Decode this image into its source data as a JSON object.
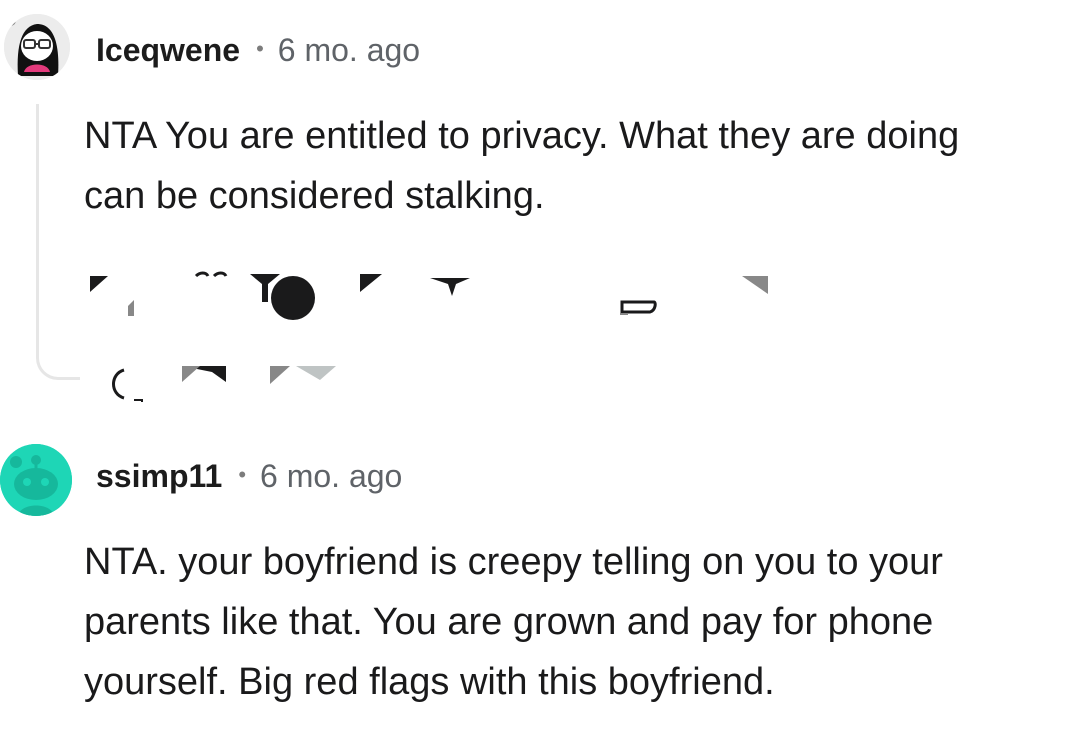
{
  "comments": [
    {
      "username": "Iceqwene",
      "separator": "•",
      "age": "6 mo. ago",
      "text_lines": [
        "NTA You are entitled to privacy. What they are doing",
        "can be considered stalking."
      ],
      "avatar_icon": "snoo-avatar-glasses-icon"
    },
    {
      "username": "ssimp11",
      "separator": "•",
      "age": "6 mo. ago",
      "text_lines": [
        "NTA. your boyfriend is creepy telling on you to your",
        "parents like that. You are grown and pay for phone",
        "yourself. Big red flags with this boyfriend."
      ],
      "avatar_icon": "snoo-avatar-icon",
      "avatar_color": "#1ed6b6"
    }
  ]
}
